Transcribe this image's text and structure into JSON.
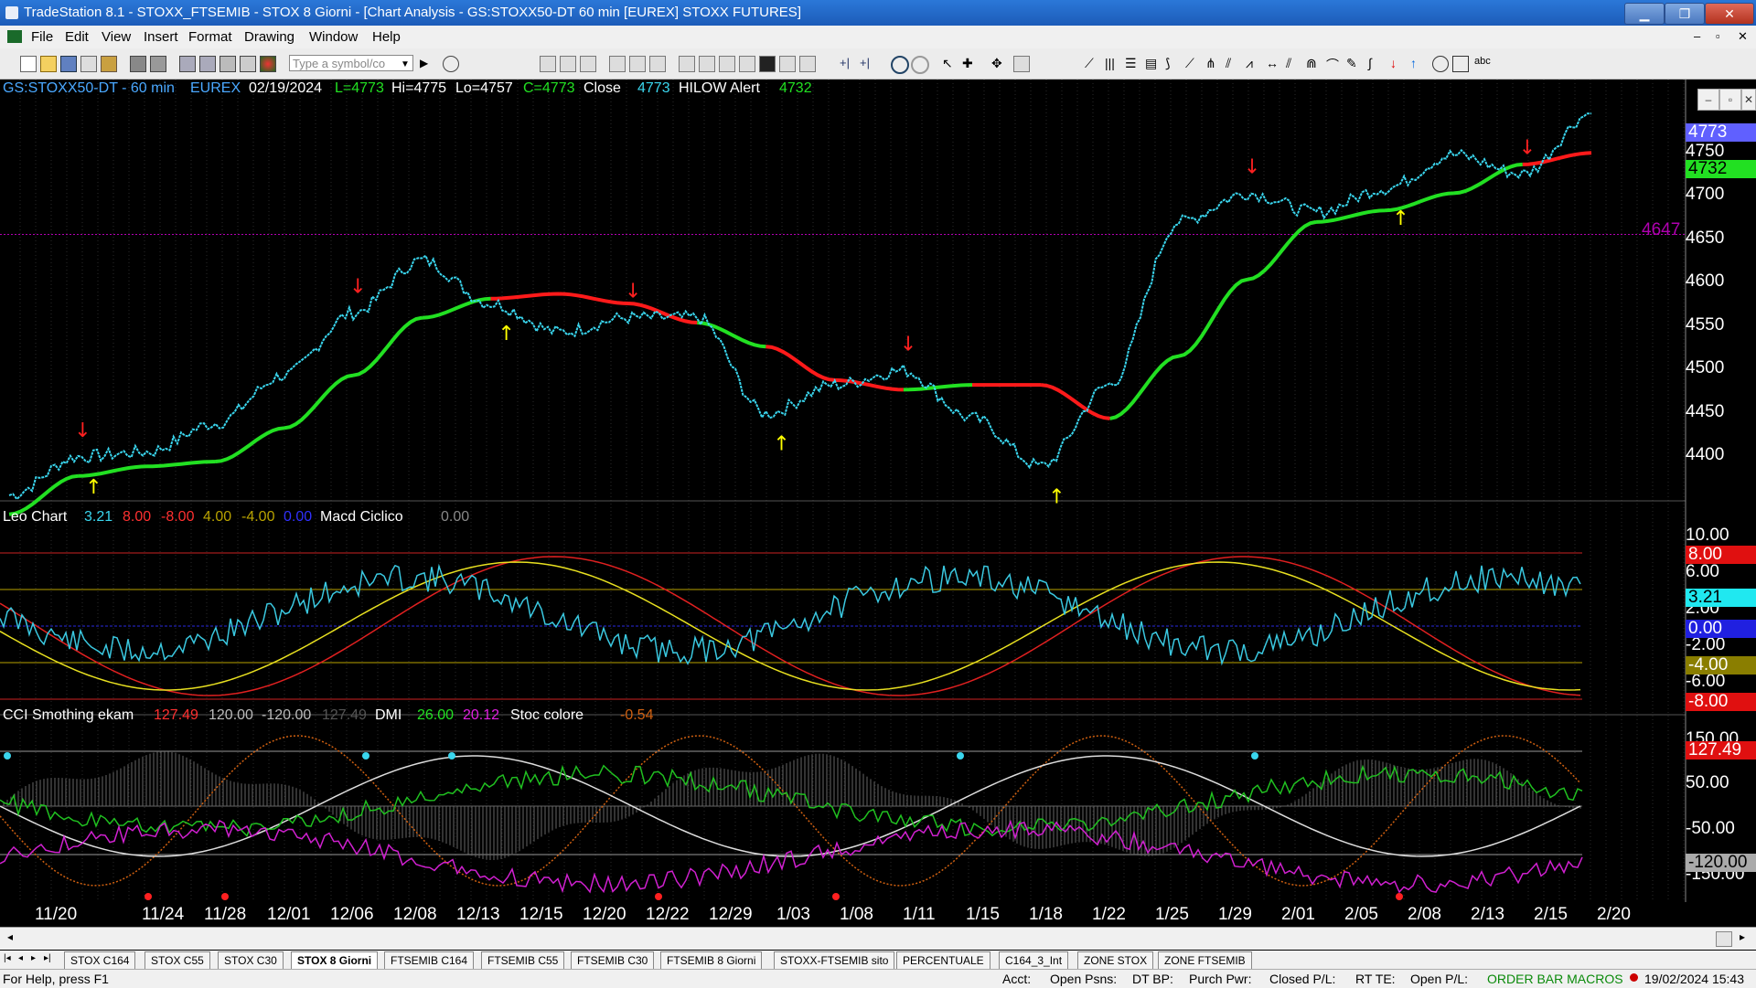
{
  "window": {
    "title": "TradeStation 8.1 - STOXX_FTSEMIB - STOX  8 Giorni - [Chart Analysis - GS:STOXX50-DT  60 min  [EUREX] STOXX FUTURES]"
  },
  "menu": [
    "File",
    "Edit",
    "View",
    "Insert",
    "Format",
    "Drawing",
    "Window",
    "Help"
  ],
  "toolbar": {
    "symbol_placeholder": "Type a symbol/co"
  },
  "chart_header": {
    "symbol": "GS:STOXX50-DT - 60 min",
    "exchange": "EUREX",
    "date": "02/19/2024",
    "last": "L=4773",
    "hi": "Hi=4775",
    "lo": "Lo=4757",
    "close": "C=4773",
    "close_label": "Close",
    "close_value": "4773",
    "indicator": "HILOW Alert",
    "indicator_value": "4732"
  },
  "price_axis": {
    "ticks": [
      "4750",
      "4700",
      "4650",
      "4600",
      "4550",
      "4500",
      "4450",
      "4400"
    ],
    "last_tag": "4773",
    "alert_tag": "4732",
    "level_label": "4647"
  },
  "panel2": {
    "name": "Leo Chart",
    "values": [
      "3.21",
      "8.00",
      "-8.00",
      "4.00",
      "-4.00",
      "0.00"
    ],
    "second": "Macd Ciclico",
    "second_value": "0.00",
    "axis_ticks": [
      "10.00",
      "6.00",
      "2.00",
      "-2.00",
      "-6.00"
    ],
    "tags": [
      "8.00",
      "3.21",
      "0.00",
      "-4.00",
      "-8.00"
    ]
  },
  "panel3": {
    "name": "CCI Smothing ekam",
    "values": [
      "127.49",
      "120.00",
      "-120.00",
      "127.49"
    ],
    "dmi": "DMI",
    "dmi_values": [
      "26.00",
      "20.12"
    ],
    "stoc": "Stoc colore",
    "stoc_value": "-0.54",
    "axis_ticks": [
      "150.00",
      "50.00",
      "-50.00",
      "-150.00"
    ],
    "tags": [
      "127.49",
      "-120.00"
    ]
  },
  "x_axis": [
    "11/20",
    "11/24",
    "11/28",
    "12/01",
    "12/06",
    "12/08",
    "12/13",
    "12/15",
    "12/20",
    "12/22",
    "12/29",
    "1/03",
    "1/08",
    "1/11",
    "1/15",
    "1/18",
    "1/22",
    "1/25",
    "1/29",
    "2/01",
    "2/05",
    "2/08",
    "2/13",
    "2/15",
    "2/20"
  ],
  "tabs": [
    "STOX C164",
    "STOX C55",
    "STOX  C30",
    "STOX  8 Giorni",
    "FTSEMIB C164",
    "FTSEMIB C55",
    "FTSEMIB C30",
    "FTSEMIB  8 Giorni",
    "STOXX-FTSEMIB sito",
    "PERCENTUALE",
    "C164_3_Int",
    "ZONE STOX",
    "ZONE FTSEMIB"
  ],
  "status": {
    "help": "For Help, press F1",
    "acct": "Acct:",
    "open_psns": "Open Psns:",
    "dt_bp": "DT BP:",
    "purch_pwr": "Purch Pwr:",
    "closed_pl": "Closed P/L:",
    "rt_te": "RT TE:",
    "open_pl": "Open P/L:",
    "modes": "ORDER BAR  MACROS",
    "datetime": "19/02/2024 15:43"
  },
  "chart_data": {
    "type": "line",
    "x": [
      "11/20",
      "11/24",
      "11/28",
      "12/01",
      "12/06",
      "12/08",
      "12/13",
      "12/15",
      "12/20",
      "12/22",
      "12/29",
      "1/03",
      "1/08",
      "1/11",
      "1/15",
      "1/18",
      "1/22",
      "1/25",
      "1/29",
      "2/01",
      "2/05",
      "2/08",
      "2/13",
      "2/15"
    ],
    "series": [
      {
        "name": "Close",
        "values": [
          4375,
          4415,
          4420,
          4450,
          4500,
          4565,
          4620,
          4575,
          4545,
          4560,
          4560,
          4460,
          4490,
          4505,
          4455,
          4405,
          4490,
          4660,
          4690,
          4670,
          4695,
          4730,
          4710,
          4773
        ]
      },
      {
        "name": "HILOW Alert",
        "values": [
          4355,
          4395,
          4405,
          4410,
          4445,
          4500,
          4560,
          4580,
          4585,
          4575,
          4555,
          4530,
          4495,
          4485,
          4490,
          4490,
          4455,
          4520,
          4600,
          4660,
          4672,
          4690,
          4720,
          4732
        ]
      }
    ],
    "ylim": [
      4370,
      4780
    ],
    "level_line": 4647
  },
  "colors": {
    "price": "#3ad6ee",
    "up_line": "#22e022",
    "down_line": "#ff1a1a",
    "up_arrow": "#ffff00",
    "down_arrow": "#ff2020"
  }
}
